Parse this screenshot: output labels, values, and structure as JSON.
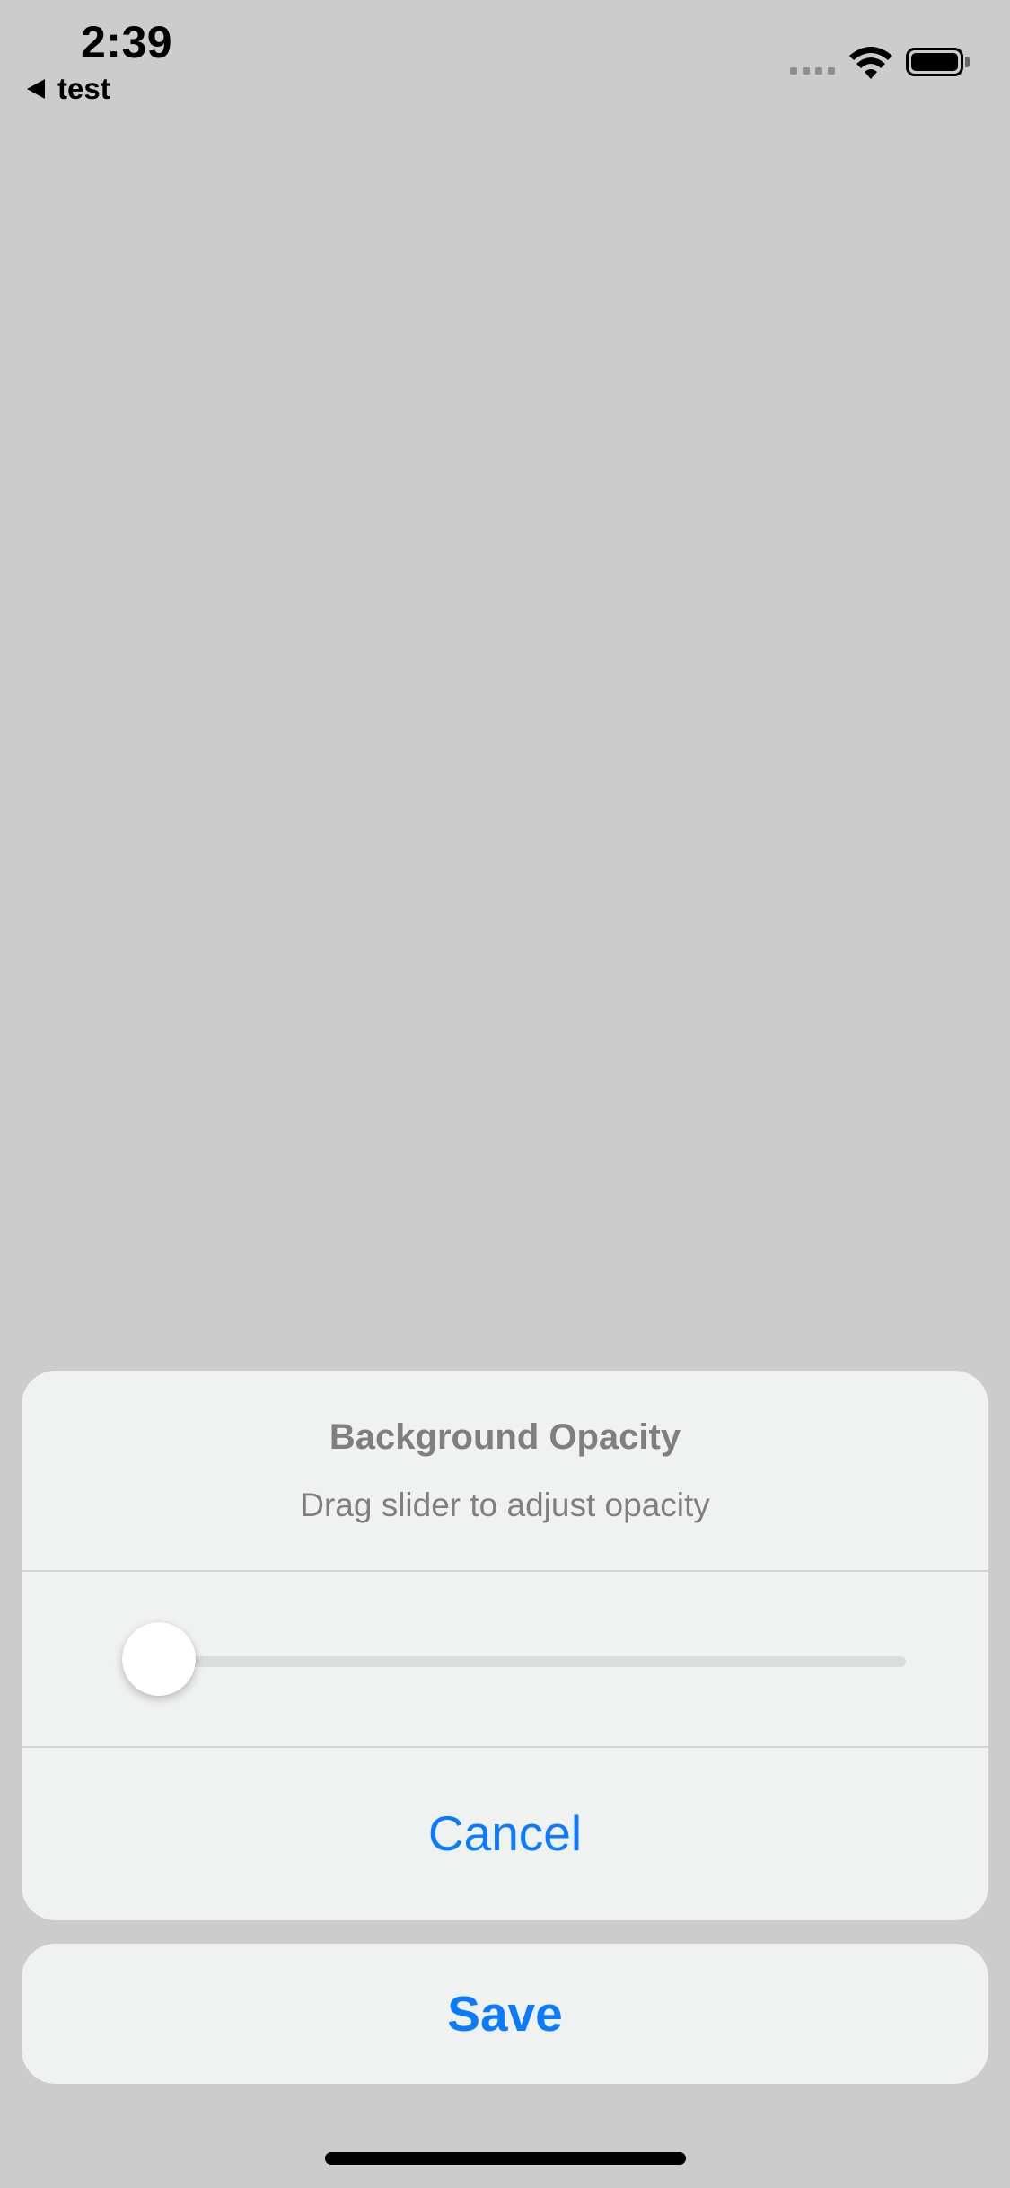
{
  "status_bar": {
    "time": "2:39",
    "back_label": "test"
  },
  "sheet": {
    "title": "Background Opacity",
    "message": "Drag slider to adjust opacity",
    "slider_value": 0.0,
    "cancel_label": "Cancel",
    "save_label": "Save"
  },
  "colors": {
    "accent": "#0a7aff",
    "background": "#cccccc",
    "sheet_background": "#f0f1f1"
  }
}
